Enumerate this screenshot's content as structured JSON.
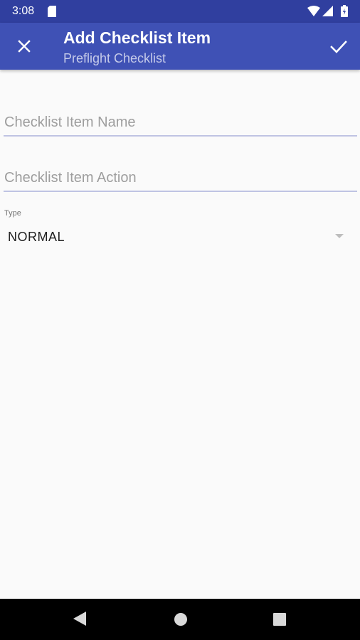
{
  "status_bar": {
    "time": "3:08",
    "icons": [
      "sd-card-icon",
      "wifi-icon",
      "signal-icon",
      "battery-icon"
    ]
  },
  "app_bar": {
    "title": "Add Checklist Item",
    "subtitle": "Preflight Checklist",
    "close_icon": "close-icon",
    "confirm_icon": "check-icon",
    "background": "#3f51b5",
    "status_bar_color": "#303f9f"
  },
  "form": {
    "name_field": {
      "placeholder": "Checklist Item Name",
      "value": ""
    },
    "action_field": {
      "placeholder": "Checklist Item Action",
      "value": ""
    },
    "type_label": "Type",
    "type_value": "NORMAL"
  },
  "nav_bar": {
    "icons": [
      "back-icon",
      "home-icon",
      "recents-icon"
    ]
  }
}
